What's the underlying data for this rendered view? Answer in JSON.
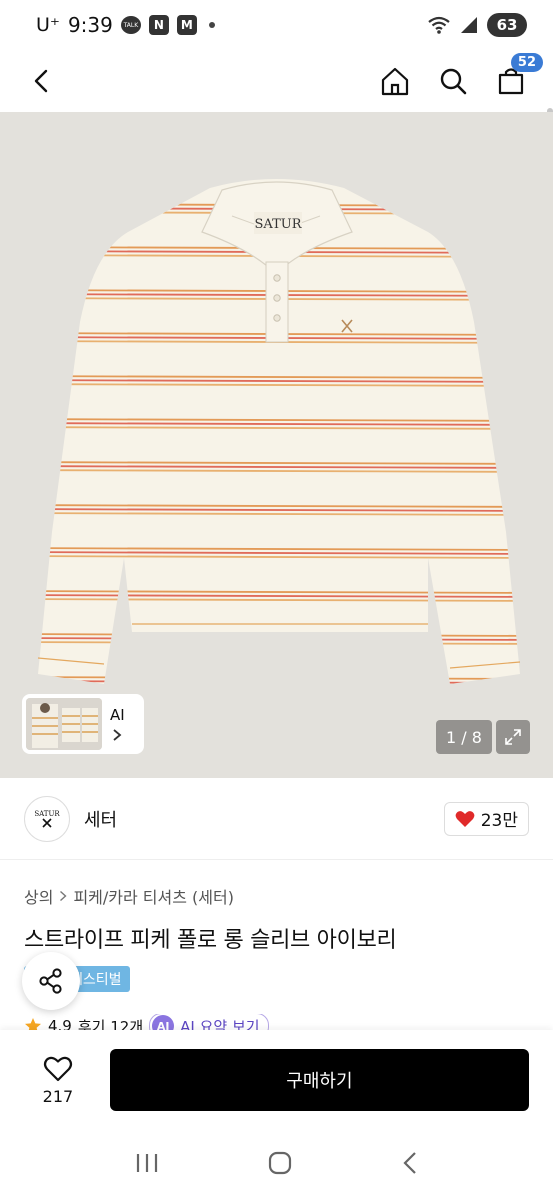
{
  "status_bar": {
    "carrier": "U⁺",
    "time": "9:39",
    "noti_talk": "TALK",
    "noti_n": "N",
    "noti_m": "M",
    "battery": "63"
  },
  "nav": {
    "cart_count": "52"
  },
  "gallery": {
    "thumb_label": "AI",
    "page_indicator": "1 / 8",
    "shirt_logo_text": "SATUR"
  },
  "brand": {
    "name": "세터",
    "logo_text": "SATUR",
    "like_count": "23만"
  },
  "product": {
    "breadcrumb": [
      "상의",
      "피케/카라 티셔츠 (세터)"
    ],
    "title": "스트라이프 피케 폴로 롱 슬리브 아이보리",
    "tag": "페스티벌",
    "rating": "4.9",
    "review_count": "후기 12개",
    "ai_summary_label": "AI 요약 보기",
    "ai_badge": "AI"
  },
  "bottom": {
    "wish_count": "217",
    "buy_label": "구매하기"
  },
  "colors": {
    "accent_blue": "#3a7bd5",
    "festival_tag": "#6fb6e3",
    "heart_red": "#e02a2a",
    "star": "#f5a623",
    "buy_button": "#000000"
  }
}
